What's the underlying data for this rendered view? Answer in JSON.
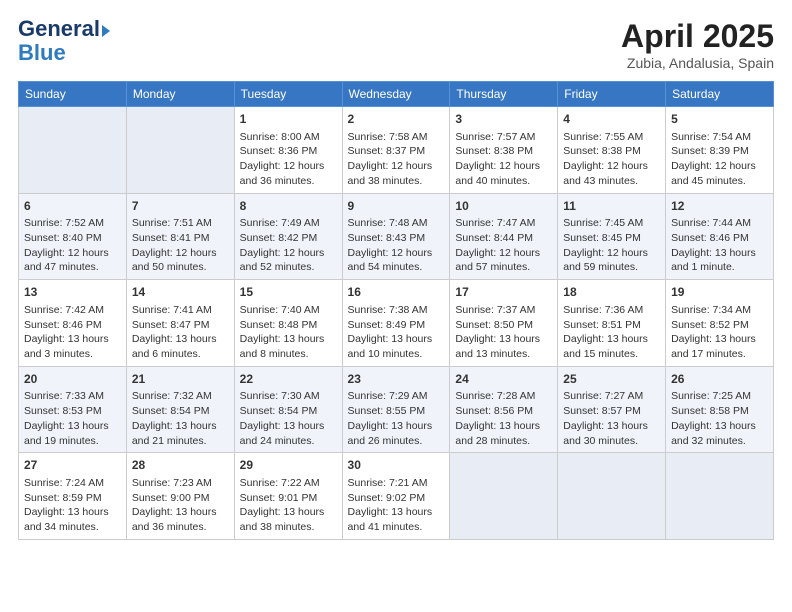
{
  "logo": {
    "general": "General",
    "blue": "Blue"
  },
  "title": "April 2025",
  "location": "Zubia, Andalusia, Spain",
  "headers": [
    "Sunday",
    "Monday",
    "Tuesday",
    "Wednesday",
    "Thursday",
    "Friday",
    "Saturday"
  ],
  "weeks": [
    [
      {
        "day": "",
        "sunrise": "",
        "sunset": "",
        "daylight": "",
        "empty": true
      },
      {
        "day": "",
        "sunrise": "",
        "sunset": "",
        "daylight": "",
        "empty": true
      },
      {
        "day": "1",
        "sunrise": "Sunrise: 8:00 AM",
        "sunset": "Sunset: 8:36 PM",
        "daylight": "Daylight: 12 hours and 36 minutes.",
        "empty": false
      },
      {
        "day": "2",
        "sunrise": "Sunrise: 7:58 AM",
        "sunset": "Sunset: 8:37 PM",
        "daylight": "Daylight: 12 hours and 38 minutes.",
        "empty": false
      },
      {
        "day": "3",
        "sunrise": "Sunrise: 7:57 AM",
        "sunset": "Sunset: 8:38 PM",
        "daylight": "Daylight: 12 hours and 40 minutes.",
        "empty": false
      },
      {
        "day": "4",
        "sunrise": "Sunrise: 7:55 AM",
        "sunset": "Sunset: 8:38 PM",
        "daylight": "Daylight: 12 hours and 43 minutes.",
        "empty": false
      },
      {
        "day": "5",
        "sunrise": "Sunrise: 7:54 AM",
        "sunset": "Sunset: 8:39 PM",
        "daylight": "Daylight: 12 hours and 45 minutes.",
        "empty": false
      }
    ],
    [
      {
        "day": "6",
        "sunrise": "Sunrise: 7:52 AM",
        "sunset": "Sunset: 8:40 PM",
        "daylight": "Daylight: 12 hours and 47 minutes.",
        "empty": false
      },
      {
        "day": "7",
        "sunrise": "Sunrise: 7:51 AM",
        "sunset": "Sunset: 8:41 PM",
        "daylight": "Daylight: 12 hours and 50 minutes.",
        "empty": false
      },
      {
        "day": "8",
        "sunrise": "Sunrise: 7:49 AM",
        "sunset": "Sunset: 8:42 PM",
        "daylight": "Daylight: 12 hours and 52 minutes.",
        "empty": false
      },
      {
        "day": "9",
        "sunrise": "Sunrise: 7:48 AM",
        "sunset": "Sunset: 8:43 PM",
        "daylight": "Daylight: 12 hours and 54 minutes.",
        "empty": false
      },
      {
        "day": "10",
        "sunrise": "Sunrise: 7:47 AM",
        "sunset": "Sunset: 8:44 PM",
        "daylight": "Daylight: 12 hours and 57 minutes.",
        "empty": false
      },
      {
        "day": "11",
        "sunrise": "Sunrise: 7:45 AM",
        "sunset": "Sunset: 8:45 PM",
        "daylight": "Daylight: 12 hours and 59 minutes.",
        "empty": false
      },
      {
        "day": "12",
        "sunrise": "Sunrise: 7:44 AM",
        "sunset": "Sunset: 8:46 PM",
        "daylight": "Daylight: 13 hours and 1 minute.",
        "empty": false
      }
    ],
    [
      {
        "day": "13",
        "sunrise": "Sunrise: 7:42 AM",
        "sunset": "Sunset: 8:46 PM",
        "daylight": "Daylight: 13 hours and 3 minutes.",
        "empty": false
      },
      {
        "day": "14",
        "sunrise": "Sunrise: 7:41 AM",
        "sunset": "Sunset: 8:47 PM",
        "daylight": "Daylight: 13 hours and 6 minutes.",
        "empty": false
      },
      {
        "day": "15",
        "sunrise": "Sunrise: 7:40 AM",
        "sunset": "Sunset: 8:48 PM",
        "daylight": "Daylight: 13 hours and 8 minutes.",
        "empty": false
      },
      {
        "day": "16",
        "sunrise": "Sunrise: 7:38 AM",
        "sunset": "Sunset: 8:49 PM",
        "daylight": "Daylight: 13 hours and 10 minutes.",
        "empty": false
      },
      {
        "day": "17",
        "sunrise": "Sunrise: 7:37 AM",
        "sunset": "Sunset: 8:50 PM",
        "daylight": "Daylight: 13 hours and 13 minutes.",
        "empty": false
      },
      {
        "day": "18",
        "sunrise": "Sunrise: 7:36 AM",
        "sunset": "Sunset: 8:51 PM",
        "daylight": "Daylight: 13 hours and 15 minutes.",
        "empty": false
      },
      {
        "day": "19",
        "sunrise": "Sunrise: 7:34 AM",
        "sunset": "Sunset: 8:52 PM",
        "daylight": "Daylight: 13 hours and 17 minutes.",
        "empty": false
      }
    ],
    [
      {
        "day": "20",
        "sunrise": "Sunrise: 7:33 AM",
        "sunset": "Sunset: 8:53 PM",
        "daylight": "Daylight: 13 hours and 19 minutes.",
        "empty": false
      },
      {
        "day": "21",
        "sunrise": "Sunrise: 7:32 AM",
        "sunset": "Sunset: 8:54 PM",
        "daylight": "Daylight: 13 hours and 21 minutes.",
        "empty": false
      },
      {
        "day": "22",
        "sunrise": "Sunrise: 7:30 AM",
        "sunset": "Sunset: 8:54 PM",
        "daylight": "Daylight: 13 hours and 24 minutes.",
        "empty": false
      },
      {
        "day": "23",
        "sunrise": "Sunrise: 7:29 AM",
        "sunset": "Sunset: 8:55 PM",
        "daylight": "Daylight: 13 hours and 26 minutes.",
        "empty": false
      },
      {
        "day": "24",
        "sunrise": "Sunrise: 7:28 AM",
        "sunset": "Sunset: 8:56 PM",
        "daylight": "Daylight: 13 hours and 28 minutes.",
        "empty": false
      },
      {
        "day": "25",
        "sunrise": "Sunrise: 7:27 AM",
        "sunset": "Sunset: 8:57 PM",
        "daylight": "Daylight: 13 hours and 30 minutes.",
        "empty": false
      },
      {
        "day": "26",
        "sunrise": "Sunrise: 7:25 AM",
        "sunset": "Sunset: 8:58 PM",
        "daylight": "Daylight: 13 hours and 32 minutes.",
        "empty": false
      }
    ],
    [
      {
        "day": "27",
        "sunrise": "Sunrise: 7:24 AM",
        "sunset": "Sunset: 8:59 PM",
        "daylight": "Daylight: 13 hours and 34 minutes.",
        "empty": false
      },
      {
        "day": "28",
        "sunrise": "Sunrise: 7:23 AM",
        "sunset": "Sunset: 9:00 PM",
        "daylight": "Daylight: 13 hours and 36 minutes.",
        "empty": false
      },
      {
        "day": "29",
        "sunrise": "Sunrise: 7:22 AM",
        "sunset": "Sunset: 9:01 PM",
        "daylight": "Daylight: 13 hours and 38 minutes.",
        "empty": false
      },
      {
        "day": "30",
        "sunrise": "Sunrise: 7:21 AM",
        "sunset": "Sunset: 9:02 PM",
        "daylight": "Daylight: 13 hours and 41 minutes.",
        "empty": false
      },
      {
        "day": "",
        "sunrise": "",
        "sunset": "",
        "daylight": "",
        "empty": true
      },
      {
        "day": "",
        "sunrise": "",
        "sunset": "",
        "daylight": "",
        "empty": true
      },
      {
        "day": "",
        "sunrise": "",
        "sunset": "",
        "daylight": "",
        "empty": true
      }
    ]
  ]
}
